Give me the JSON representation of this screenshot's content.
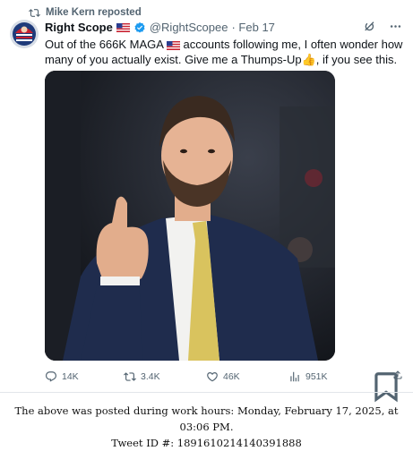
{
  "repost": {
    "text": "Mike Kern reposted"
  },
  "author": {
    "name": "Right Scope",
    "handle": "@RightScopee",
    "date": "· Feb 17"
  },
  "tweet": {
    "text_part1": "Out of the 666K MAGA ",
    "text_part2": " accounts following me, I often wonder how many of you actually exist. Give me a Thumps-Up",
    "text_part3": ", if you see this."
  },
  "actions": {
    "replies": "14K",
    "reposts": "3.4K",
    "likes": "46K",
    "views": "951K"
  },
  "caption": {
    "line1": "The above was posted during work hours: Monday, February 17, 2025, at 03:06 PM.",
    "line2": "Tweet ID #: 1891610214140391888"
  },
  "colors": {
    "accent": "#1d9bf0",
    "muted": "#536471",
    "text": "#0f1419"
  }
}
